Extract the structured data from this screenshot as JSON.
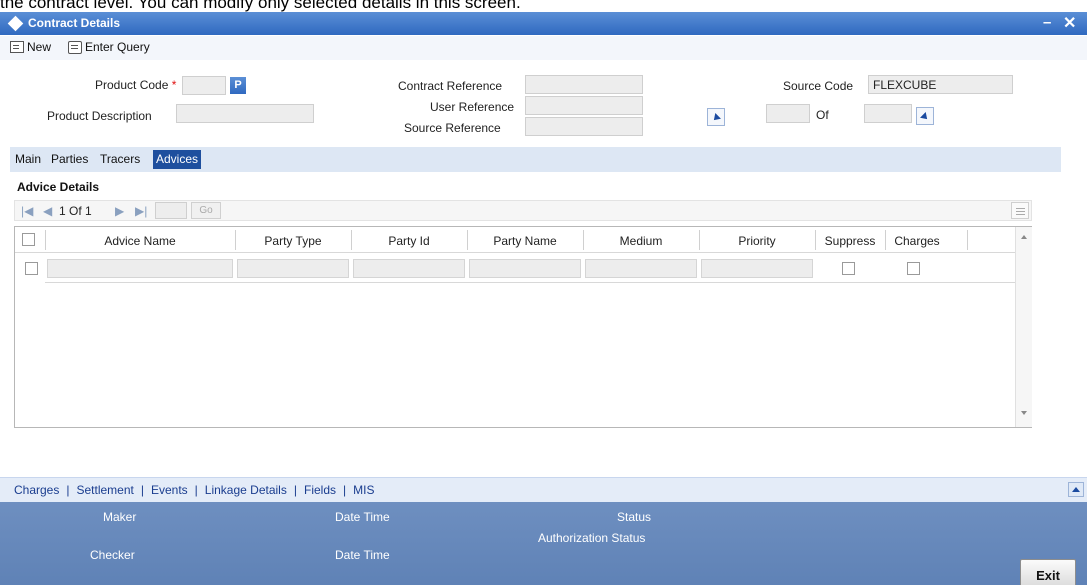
{
  "caption": "the contract level. You can modify only selected details in this screen.",
  "window": {
    "title": "Contract Details",
    "minimize": "–",
    "close": "✕"
  },
  "toolbar": {
    "new_label": "New",
    "enter_query_label": "Enter Query"
  },
  "form": {
    "product_code_label": "Product Code",
    "required_mark": "*",
    "product_code_value": "",
    "product_lov": "P",
    "product_description_label": "Product Description",
    "product_description_value": "",
    "contract_reference_label": "Contract Reference",
    "contract_reference_value": "",
    "user_reference_label": "User Reference",
    "user_reference_value": "",
    "source_reference_label": "Source Reference",
    "source_reference_value": "",
    "source_code_label": "Source Code",
    "source_code_value": "FLEXCUBE",
    "version_current": "",
    "of_label": "Of",
    "version_total": ""
  },
  "tabs": [
    {
      "label": "Main",
      "active": false
    },
    {
      "label": "Parties",
      "active": false
    },
    {
      "label": "Tracers",
      "active": false
    },
    {
      "label": "Advices",
      "active": true
    }
  ],
  "advice_details": {
    "section_title": "Advice Details",
    "pager": {
      "first": "|◀",
      "prev": "◀",
      "page_text": "1 Of 1",
      "next": "▶",
      "last": "▶|",
      "go_label": "Go",
      "page_input": ""
    },
    "columns": [
      "Advice Name",
      "Party Type",
      "Party Id",
      "Party Name",
      "Medium",
      "Priority",
      "Suppress",
      "Charges"
    ],
    "rows": [
      {
        "advice_name": "",
        "party_type": "",
        "party_id": "",
        "party_name": "",
        "medium": "",
        "priority": "",
        "suppress": false,
        "charges": false
      }
    ]
  },
  "links": [
    "Charges",
    "Settlement",
    "Events",
    "Linkage Details",
    "Fields",
    "MIS"
  ],
  "audit": {
    "maker_label": "Maker",
    "maker_date_time_label": "Date Time",
    "status_label": "Status",
    "checker_label": "Checker",
    "checker_date_time_label": "Date Time",
    "authorization_status_label": "Authorization Status",
    "exit_label": "Exit"
  }
}
